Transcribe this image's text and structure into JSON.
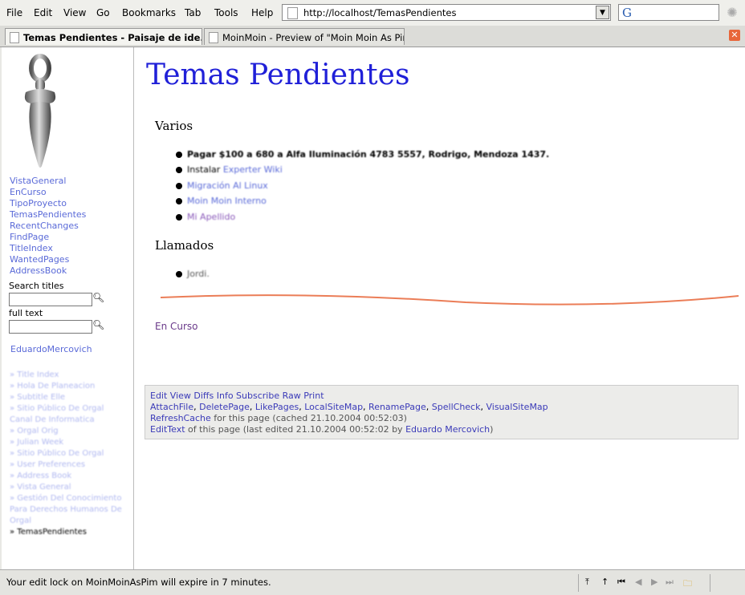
{
  "menu": {
    "file": "File",
    "edit": "Edit",
    "view": "View",
    "go": "Go",
    "bookmarks": "Bookmarks",
    "tab": "Tab",
    "tools": "Tools",
    "help": "Help"
  },
  "urlbar": {
    "url": "http://localhost/TemasPendientes"
  },
  "search": {
    "engine_letter": "G"
  },
  "tabs": [
    {
      "label": "Temas Pendientes - Paisaje de ide..."
    },
    {
      "label": "MoinMoin - Preview of \"Moin Moin As Pim\""
    }
  ],
  "sidebar": {
    "nav": [
      "VistaGeneral",
      "EnCurso",
      "TipoProyecto",
      "TemasPendientes",
      "RecentChanges",
      "FindPage",
      "TitleIndex",
      "WantedPages",
      "AddressBook"
    ],
    "search_titles_label": "Search titles",
    "full_text_label": "full text",
    "user": "EduardoMercovich",
    "trail": [
      "Title Index",
      "Hola De Planeacion",
      "Subtitle Elle",
      "Sitio Público De Orgal Canal De Informatica",
      "Orgal Orig",
      "Julian Week",
      "Sitio Público De Orgal",
      "User Preferences",
      "Address Book",
      "Vista General",
      "Gestión Del Conocimiento Para Derechos Humanos De Orgal"
    ],
    "trail_current": "TemasPendientes"
  },
  "page": {
    "title": "Temas Pendientes",
    "section1": "Varios",
    "items1": [
      {
        "text": "Pagar $100 a 680 a Alfa Iluminación 4783 5557, Rodrigo, Mendoza 1437.",
        "link": ""
      },
      {
        "text": "Instalar ",
        "link": "Experter Wiki"
      },
      {
        "text": "",
        "link": "Migración Al Linux"
      },
      {
        "text": "",
        "link": "Moin Moin Interno"
      },
      {
        "text": "",
        "link": "Mi Apellido"
      }
    ],
    "section2": "Llamados",
    "items2": [
      {
        "text": "Jordi."
      }
    ],
    "link_encurso": "En Curso"
  },
  "footer": {
    "line1": "Edit View Diffs Info Subscribe Raw Print",
    "line2": [
      "AttachFile",
      "DeletePage",
      "LikePages",
      "LocalSiteMap",
      "RenamePage",
      "SpellCheck",
      "VisualSiteMap"
    ],
    "refresh_link": "RefreshCache",
    "refresh_text": " for this page (cached 21.10.2004 00:52:03)",
    "edit_link": "EditText",
    "edit_text": " of this page (last edited 21.10.2004 00:52:02 by ",
    "editor": "Eduardo Mercovich",
    "edit_close": ")"
  },
  "status": {
    "text": "Your edit lock on MoinMoinAsPim will expire in 7 minutes."
  },
  "colors": {
    "title": "#2020d8",
    "link": "#5a6ad8",
    "visited": "#6a3a8a",
    "accent_line": "#e8663a"
  }
}
